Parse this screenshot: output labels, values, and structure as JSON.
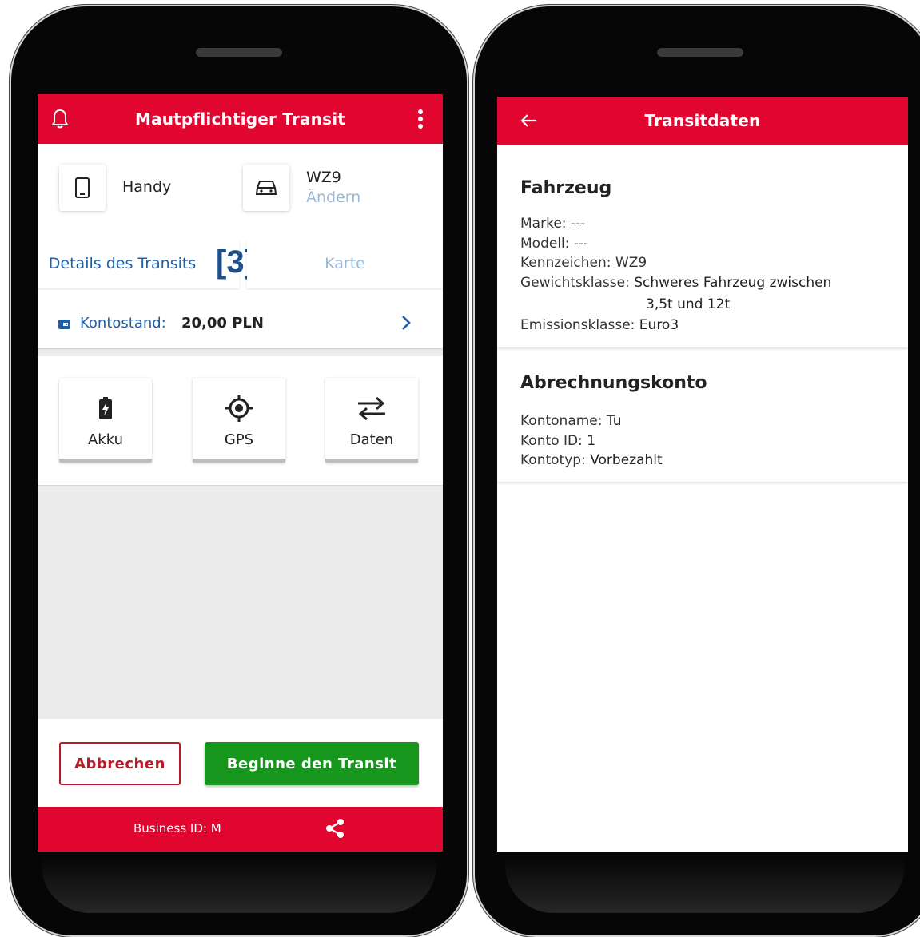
{
  "left_screen": {
    "title": "Mautpflichtiger Transit",
    "device": {
      "label": "Handy"
    },
    "vehicle": {
      "plate": "WZ9",
      "change_label": "Ändern"
    },
    "tabs": [
      {
        "label": "Details des Transits"
      },
      {
        "label": "Karte"
      }
    ],
    "marker": "[3]",
    "balance": {
      "label": "Kontostand:",
      "value": "20,00 PLN"
    },
    "tiles": [
      {
        "label": "Akku"
      },
      {
        "label": "GPS"
      },
      {
        "label": "Daten"
      }
    ],
    "cancel_label": "Abbrechen",
    "start_label": "Beginne den Transit",
    "business_id_label": "Business ID:",
    "business_id_value": "M"
  },
  "right_screen": {
    "title": "Transitdaten",
    "vehicle_section": {
      "title": "Fahrzeug",
      "brand_label": "Marke:",
      "brand_value": "---",
      "model_label": "Modell:",
      "model_value": "---",
      "plate_label": "Kennzeichen:",
      "plate_value": "WZ9",
      "weight_label": "Gewichtsklasse:",
      "weight_value_1": "Schweres Fahrzeug zwischen",
      "weight_value_2": "3,5t und 12t",
      "emission_label": "Emissionsklasse:",
      "emission_value": "Euro3"
    },
    "account_section": {
      "title": "Abrechnungskonto",
      "name_label": "Kontoname:",
      "name_value": "Tu",
      "id_label": "Konto ID:",
      "id_value": "1",
      "type_label": "Kontotyp:",
      "type_value": "Vorbezahlt"
    }
  },
  "colors": {
    "primary_red": "#e0062f",
    "green": "#16961d",
    "link_blue": "#1d5fa8",
    "marker_blue": "#1d4f8a"
  },
  "icons": [
    "bell-icon",
    "more-vert-icon",
    "phone-icon",
    "car-icon",
    "wallet-icon",
    "chevron-right-icon",
    "battery-icon",
    "gps-target-icon",
    "swap-arrows-icon",
    "share-icon",
    "back-arrow-icon"
  ]
}
